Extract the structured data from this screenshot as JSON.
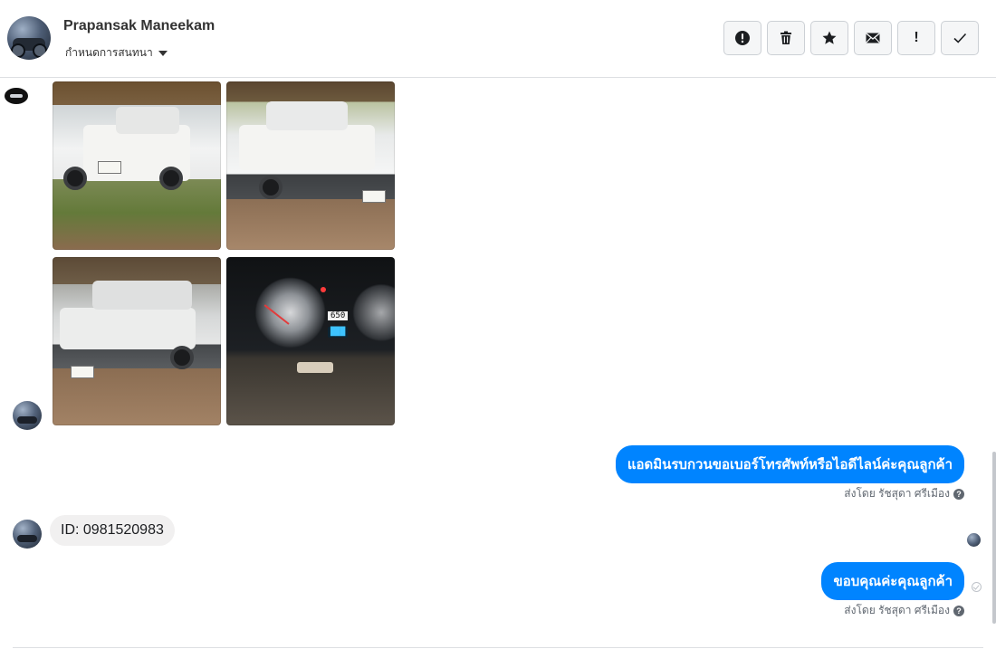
{
  "header": {
    "contact_name": "Prapansak Maneekam",
    "assign_label": "กำหนดการสนทนา",
    "toolbar": [
      {
        "name": "spam-button",
        "icon": "alert-circle-icon"
      },
      {
        "name": "delete-button",
        "icon": "trash-icon"
      },
      {
        "name": "star-button",
        "icon": "star-icon"
      },
      {
        "name": "mark-unread-button",
        "icon": "envelope-icon"
      },
      {
        "name": "follow-up-button",
        "icon": "exclamation-icon",
        "glyph": "!"
      },
      {
        "name": "mark-done-button",
        "icon": "check-icon"
      }
    ]
  },
  "thread": {
    "photos": [
      {
        "name": "photo-truck-rear"
      },
      {
        "name": "photo-truck-front-right"
      },
      {
        "name": "photo-truck-front-left"
      },
      {
        "name": "photo-dashboard-gauge",
        "odometer": "650"
      }
    ],
    "messages": [
      {
        "direction": "out",
        "text": "แอดมินรบกวนขอเบอร์โทรศัพท์หรือไอดีไลน์ค่ะคุณลูกค้า",
        "sent_by": "ส่งโดย รัชสุดา ศรีเมือง"
      },
      {
        "direction": "in",
        "text": "ID: 0981520983"
      },
      {
        "direction": "out",
        "text": "ขอบคุณค่ะคุณลูกค้า",
        "sent_by": "ส่งโดย รัชสุดา ศรีเมือง"
      }
    ]
  },
  "colors": {
    "accent": "#0084ff",
    "incoming_bubble": "#f1f0f0",
    "border": "#dddfe2"
  }
}
